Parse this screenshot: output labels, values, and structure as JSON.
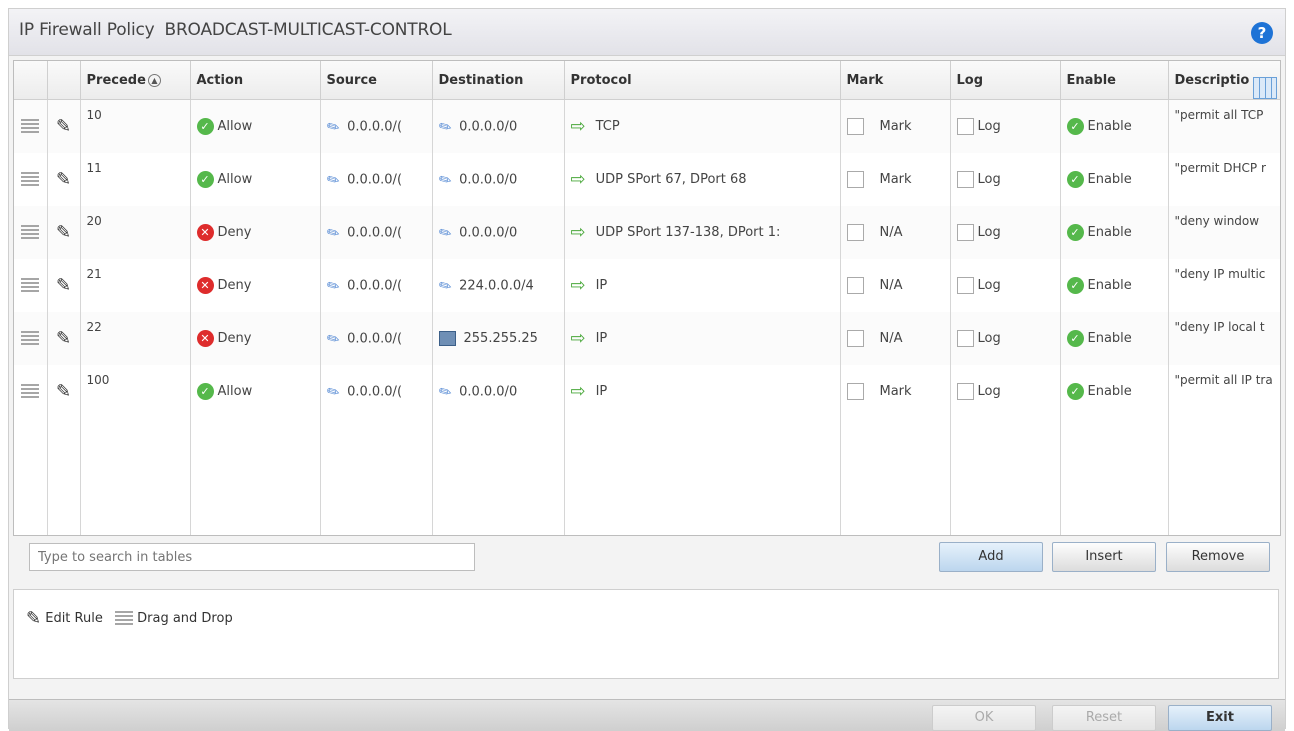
{
  "window": {
    "title": "IP Firewall Policy",
    "policy_name": "BROADCAST-MULTICAST-CONTROL",
    "help_icon": "help-icon"
  },
  "table": {
    "headers": {
      "precedence": "Precede",
      "action": "Action",
      "source": "Source",
      "destination": "Destination",
      "protocol": "Protocol",
      "mark": "Mark",
      "log": "Log",
      "enable": "Enable",
      "description": "Descriptio"
    },
    "rows": [
      {
        "precedence": "10",
        "action": "Allow",
        "source": "0.0.0.0/(",
        "destination": "0.0.0.0/0",
        "protocol": "TCP",
        "mark": "Mark",
        "log": "Log",
        "enable": "Enable",
        "description": "\"permit all TCP"
      },
      {
        "precedence": "11",
        "action": "Allow",
        "source": "0.0.0.0/(",
        "destination": "0.0.0.0/0",
        "protocol": "UDP SPort 67, DPort 68",
        "mark": "Mark",
        "log": "Log",
        "enable": "Enable",
        "description": "\"permit DHCP r"
      },
      {
        "precedence": "20",
        "action": "Deny",
        "source": "0.0.0.0/(",
        "destination": "0.0.0.0/0",
        "protocol": "UDP SPort 137-138, DPort 1:",
        "mark": "N/A",
        "log": "Log",
        "enable": "Enable",
        "description": "\"deny window"
      },
      {
        "precedence": "21",
        "action": "Deny",
        "source": "0.0.0.0/(",
        "destination": "224.0.0.0/4",
        "protocol": "IP",
        "mark": "N/A",
        "log": "Log",
        "enable": "Enable",
        "description": "\"deny IP multic"
      },
      {
        "precedence": "22",
        "action": "Deny",
        "source": "0.0.0.0/(",
        "destination": "255.255.25",
        "protocol": "IP",
        "mark": "N/A",
        "log": "Log",
        "enable": "Enable",
        "description": "\"deny IP local t"
      },
      {
        "precedence": "100",
        "action": "Allow",
        "source": "0.0.0.0/(",
        "destination": "0.0.0.0/0",
        "protocol": "IP",
        "mark": "Mark",
        "log": "Log",
        "enable": "Enable",
        "description": "\"permit all IP tra"
      }
    ]
  },
  "search": {
    "placeholder": "Type to search in tables"
  },
  "buttons": {
    "add": "Add",
    "insert": "Insert",
    "remove": "Remove",
    "ok": "OK",
    "reset": "Reset",
    "exit": "Exit"
  },
  "legend": {
    "edit": "Edit Rule",
    "drag": "Drag and Drop"
  }
}
